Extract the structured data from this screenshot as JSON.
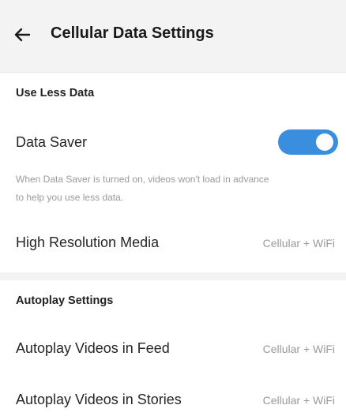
{
  "header": {
    "back_icon": "arrow-left-icon",
    "title": "Cellular Data Settings"
  },
  "use_less_data": {
    "section_title": "Use Less Data",
    "data_saver": {
      "label": "Data Saver",
      "enabled": true,
      "toggle_color": "#3b8ede"
    },
    "description_line1": "When Data Saver is turned on, videos won't load in advance",
    "description_line2": "to help you use less data.",
    "high_resolution_media": {
      "label": "High Resolution Media",
      "value": "Cellular + WiFi"
    }
  },
  "autoplay": {
    "section_title": "Autoplay Settings",
    "feed": {
      "label": "Autoplay Videos in Feed",
      "value": "Cellular + WiFi"
    },
    "stories": {
      "label": "Autoplay Videos in Stories",
      "value": "Cellular + WiFi"
    }
  }
}
